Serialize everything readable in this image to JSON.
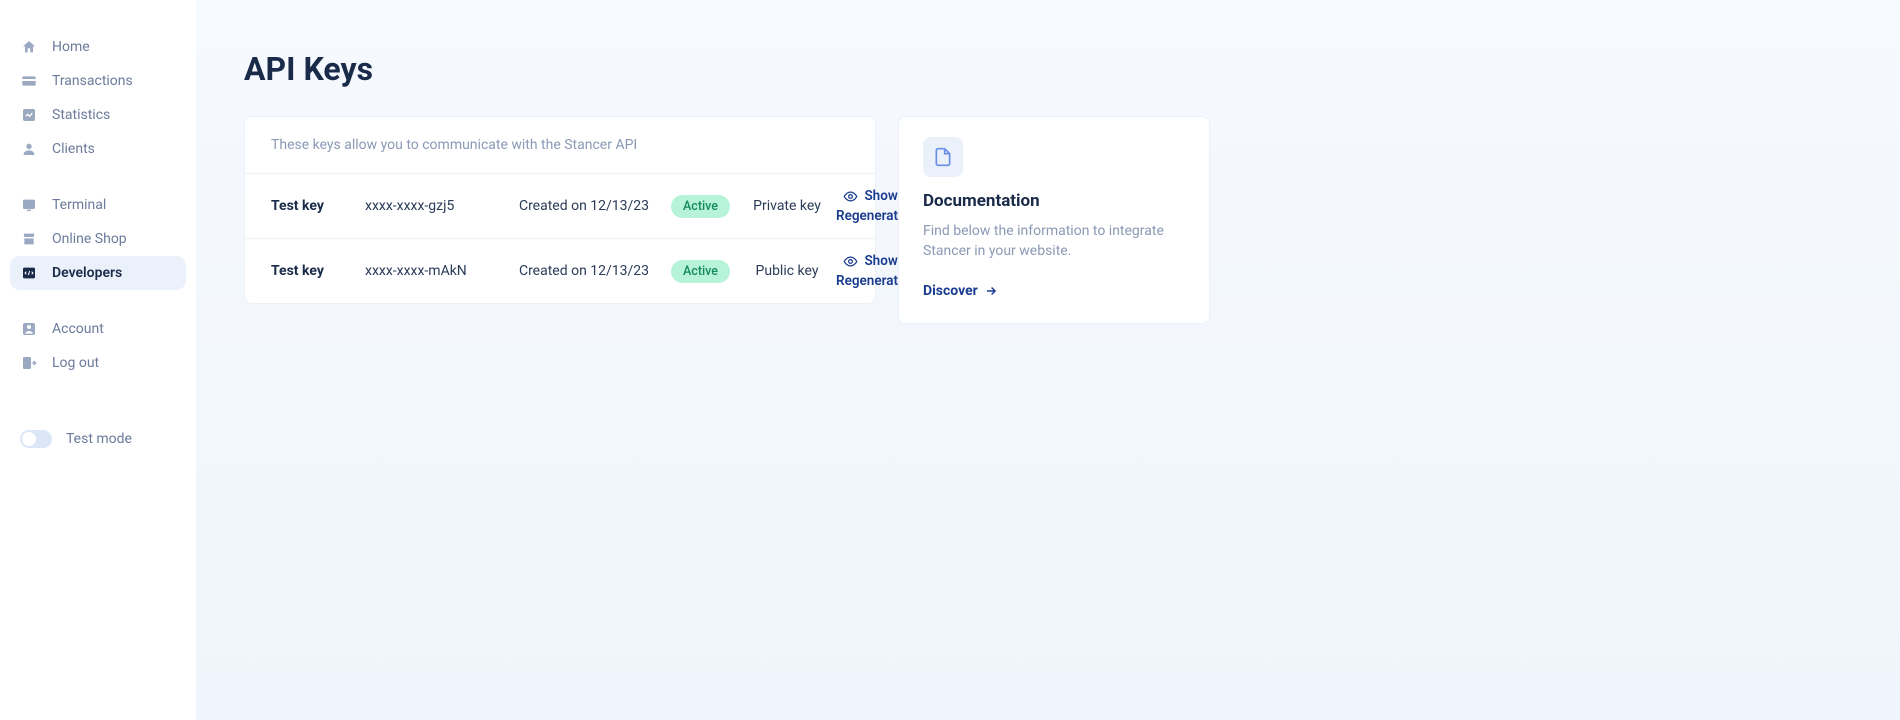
{
  "sidebar": {
    "group1": [
      {
        "label": "Home"
      },
      {
        "label": "Transactions"
      },
      {
        "label": "Statistics"
      },
      {
        "label": "Clients"
      }
    ],
    "group2": [
      {
        "label": "Terminal"
      },
      {
        "label": "Online Shop"
      },
      {
        "label": "Developers"
      }
    ],
    "group3": [
      {
        "label": "Account"
      },
      {
        "label": "Log out"
      }
    ],
    "test_mode_label": "Test mode"
  },
  "page": {
    "title": "API Keys"
  },
  "keys_card": {
    "description": "These keys allow you to communicate with the Stancer API",
    "rows": [
      {
        "label": "Test key",
        "masked": "xxxx-xxxx-gzj5",
        "created": "Created on 12/13/23",
        "status": "Active",
        "type": "Private key",
        "show": "Show",
        "regenerate": "Regenerate"
      },
      {
        "label": "Test key",
        "masked": "xxxx-xxxx-mAkN",
        "created": "Created on 12/13/23",
        "status": "Active",
        "type": "Public key",
        "show": "Show",
        "regenerate": "Regenerate"
      }
    ]
  },
  "doc_card": {
    "title": "Documentation",
    "description": "Find below the information to integrate Stancer in your website.",
    "link": "Discover"
  }
}
